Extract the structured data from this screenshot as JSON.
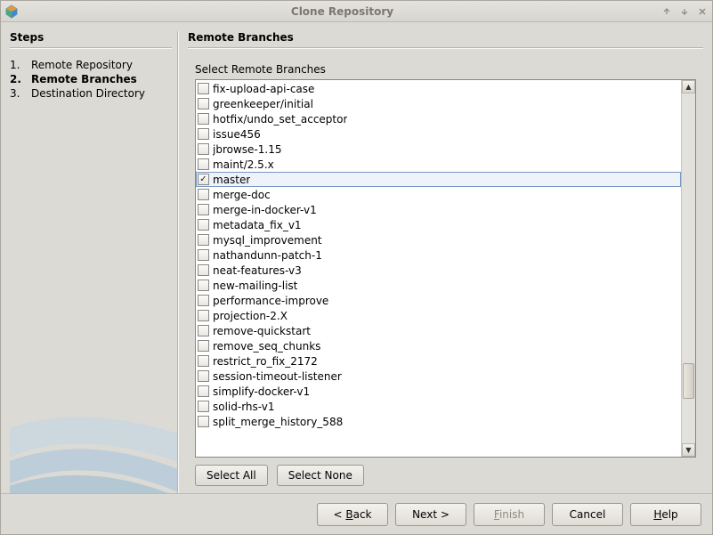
{
  "window": {
    "title": "Clone Repository"
  },
  "steps": {
    "header": "Steps",
    "items": [
      {
        "num": "1.",
        "label": "Remote Repository",
        "current": false
      },
      {
        "num": "2.",
        "label": "Remote Branches",
        "current": true
      },
      {
        "num": "3.",
        "label": "Destination Directory",
        "current": false
      }
    ]
  },
  "page": {
    "header": "Remote Branches",
    "section_label": "Select Remote Branches"
  },
  "branches": [
    {
      "name": "fix-upload-api-case",
      "checked": false,
      "selected": false
    },
    {
      "name": "greenkeeper/initial",
      "checked": false,
      "selected": false
    },
    {
      "name": "hotfix/undo_set_acceptor",
      "checked": false,
      "selected": false
    },
    {
      "name": "issue456",
      "checked": false,
      "selected": false
    },
    {
      "name": "jbrowse-1.15",
      "checked": false,
      "selected": false
    },
    {
      "name": "maint/2.5.x",
      "checked": false,
      "selected": false
    },
    {
      "name": "master",
      "checked": true,
      "selected": true
    },
    {
      "name": "merge-doc",
      "checked": false,
      "selected": false
    },
    {
      "name": "merge-in-docker-v1",
      "checked": false,
      "selected": false
    },
    {
      "name": "metadata_fix_v1",
      "checked": false,
      "selected": false
    },
    {
      "name": "mysql_improvement",
      "checked": false,
      "selected": false
    },
    {
      "name": "nathandunn-patch-1",
      "checked": false,
      "selected": false
    },
    {
      "name": "neat-features-v3",
      "checked": false,
      "selected": false
    },
    {
      "name": "new-mailing-list",
      "checked": false,
      "selected": false
    },
    {
      "name": "performance-improve",
      "checked": false,
      "selected": false
    },
    {
      "name": "projection-2.X",
      "checked": false,
      "selected": false
    },
    {
      "name": "remove-quickstart",
      "checked": false,
      "selected": false
    },
    {
      "name": "remove_seq_chunks",
      "checked": false,
      "selected": false
    },
    {
      "name": "restrict_ro_fix_2172",
      "checked": false,
      "selected": false
    },
    {
      "name": "session-timeout-listener",
      "checked": false,
      "selected": false
    },
    {
      "name": "simplify-docker-v1",
      "checked": false,
      "selected": false
    },
    {
      "name": "solid-rhs-v1",
      "checked": false,
      "selected": false
    },
    {
      "name": "split_merge_history_588",
      "checked": false,
      "selected": false
    }
  ],
  "buttons": {
    "select_all": "Select All",
    "select_none": "Select None",
    "back_prefix": "< ",
    "back_accel": "B",
    "back_suffix": "ack",
    "next_prefix": "Next ",
    "next_suffix": ">",
    "finish_accel": "F",
    "finish_suffix": "inish",
    "cancel": "Cancel",
    "help_accel": "H",
    "help_suffix": "elp"
  }
}
